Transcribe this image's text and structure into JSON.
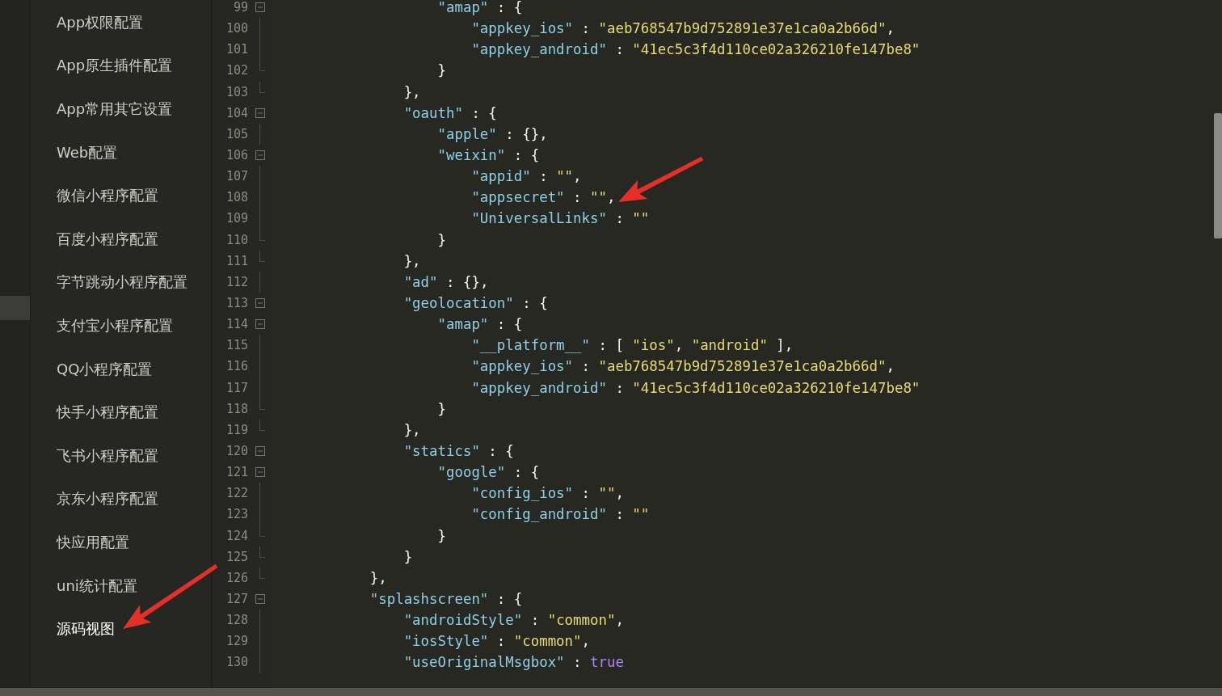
{
  "sidebar": {
    "items": [
      {
        "label": "App权限配置",
        "selected": false,
        "arrow": false
      },
      {
        "label": "App原生插件配置",
        "selected": false,
        "arrow": false
      },
      {
        "label": "App常用其它设置",
        "selected": false,
        "arrow": false
      },
      {
        "label": "Web配置",
        "selected": false,
        "arrow": false
      },
      {
        "label": "微信小程序配置",
        "selected": false,
        "arrow": false
      },
      {
        "label": "百度小程序配置",
        "selected": false,
        "arrow": false
      },
      {
        "label": "字节跳动小程序配置",
        "selected": false,
        "arrow": false
      },
      {
        "label": "支付宝小程序配置",
        "selected": false,
        "arrow": false
      },
      {
        "label": "QQ小程序配置",
        "selected": false,
        "arrow": false
      },
      {
        "label": "快手小程序配置",
        "selected": false,
        "arrow": false
      },
      {
        "label": "飞书小程序配置",
        "selected": false,
        "arrow": false
      },
      {
        "label": "京东小程序配置",
        "selected": false,
        "arrow": false
      },
      {
        "label": "快应用配置",
        "selected": false,
        "arrow": false
      },
      {
        "label": "uni统计配置",
        "selected": false,
        "arrow": false
      },
      {
        "label": "源码视图",
        "selected": true,
        "arrow": true
      }
    ]
  },
  "editor": {
    "lines": [
      {
        "number": "99",
        "fold_start": true,
        "fold_end": false,
        "arrow": false,
        "tokens": [
          {
            "kind": "key",
            "text": "                \"amap\""
          },
          {
            "kind": "plain",
            "text": " : {"
          }
        ]
      },
      {
        "number": "100",
        "fold_start": false,
        "fold_end": false,
        "arrow": false,
        "tokens": [
          {
            "kind": "key",
            "text": "                    \"appkey_ios\""
          },
          {
            "kind": "plain",
            "text": " : "
          },
          {
            "kind": "string",
            "text": "\"aeb768547b9d752891e37e1ca0a2b66d\""
          },
          {
            "kind": "plain",
            "text": ","
          }
        ]
      },
      {
        "number": "101",
        "fold_start": false,
        "fold_end": false,
        "arrow": false,
        "tokens": [
          {
            "kind": "key",
            "text": "                    \"appkey_android\""
          },
          {
            "kind": "plain",
            "text": " : "
          },
          {
            "kind": "string",
            "text": "\"41ec5c3f4d110ce02a326210fe147be8\""
          }
        ]
      },
      {
        "number": "102",
        "fold_start": false,
        "fold_end": true,
        "arrow": false,
        "tokens": [
          {
            "kind": "plain",
            "text": "                }"
          }
        ]
      },
      {
        "number": "103",
        "fold_start": false,
        "fold_end": true,
        "arrow": false,
        "tokens": [
          {
            "kind": "plain",
            "text": "            },"
          }
        ]
      },
      {
        "number": "104",
        "fold_start": true,
        "fold_end": false,
        "arrow": false,
        "tokens": [
          {
            "kind": "key",
            "text": "            \"oauth\""
          },
          {
            "kind": "plain",
            "text": " : {"
          }
        ]
      },
      {
        "number": "105",
        "fold_start": false,
        "fold_end": false,
        "arrow": false,
        "tokens": [
          {
            "kind": "key",
            "text": "                \"apple\""
          },
          {
            "kind": "plain",
            "text": " : {},"
          }
        ]
      },
      {
        "number": "106",
        "fold_start": true,
        "fold_end": false,
        "arrow": false,
        "tokens": [
          {
            "kind": "key",
            "text": "                \"weixin\""
          },
          {
            "kind": "plain",
            "text": " : {"
          }
        ]
      },
      {
        "number": "107",
        "fold_start": false,
        "fold_end": false,
        "arrow": false,
        "tokens": [
          {
            "kind": "key",
            "text": "                    \"appid\""
          },
          {
            "kind": "plain",
            "text": " : "
          },
          {
            "kind": "string",
            "text": "\"\""
          },
          {
            "kind": "plain",
            "text": ","
          }
        ]
      },
      {
        "number": "108",
        "fold_start": false,
        "fold_end": false,
        "arrow": true,
        "tokens": [
          {
            "kind": "key",
            "text": "                    \"appsecret\""
          },
          {
            "kind": "plain",
            "text": " : "
          },
          {
            "kind": "string",
            "text": "\"\""
          },
          {
            "kind": "plain",
            "text": ","
          }
        ]
      },
      {
        "number": "109",
        "fold_start": false,
        "fold_end": false,
        "arrow": false,
        "tokens": [
          {
            "kind": "key",
            "text": "                    \"UniversalLinks\""
          },
          {
            "kind": "plain",
            "text": " : "
          },
          {
            "kind": "string",
            "text": "\"\""
          }
        ]
      },
      {
        "number": "110",
        "fold_start": false,
        "fold_end": true,
        "arrow": false,
        "tokens": [
          {
            "kind": "plain",
            "text": "                }"
          }
        ]
      },
      {
        "number": "111",
        "fold_start": false,
        "fold_end": true,
        "arrow": false,
        "tokens": [
          {
            "kind": "plain",
            "text": "            },"
          }
        ]
      },
      {
        "number": "112",
        "fold_start": false,
        "fold_end": false,
        "arrow": false,
        "tokens": [
          {
            "kind": "key",
            "text": "            \"ad\""
          },
          {
            "kind": "plain",
            "text": " : {},"
          }
        ]
      },
      {
        "number": "113",
        "fold_start": true,
        "fold_end": false,
        "arrow": false,
        "tokens": [
          {
            "kind": "key",
            "text": "            \"geolocation\""
          },
          {
            "kind": "plain",
            "text": " : {"
          }
        ]
      },
      {
        "number": "114",
        "fold_start": true,
        "fold_end": false,
        "arrow": false,
        "tokens": [
          {
            "kind": "key",
            "text": "                \"amap\""
          },
          {
            "kind": "plain",
            "text": " : {"
          }
        ]
      },
      {
        "number": "115",
        "fold_start": false,
        "fold_end": false,
        "arrow": false,
        "tokens": [
          {
            "kind": "key",
            "text": "                    \"__platform__\""
          },
          {
            "kind": "plain",
            "text": " : [ "
          },
          {
            "kind": "string",
            "text": "\"ios\""
          },
          {
            "kind": "plain",
            "text": ", "
          },
          {
            "kind": "string",
            "text": "\"android\""
          },
          {
            "kind": "plain",
            "text": " ],"
          }
        ]
      },
      {
        "number": "116",
        "fold_start": false,
        "fold_end": false,
        "arrow": false,
        "tokens": [
          {
            "kind": "key",
            "text": "                    \"appkey_ios\""
          },
          {
            "kind": "plain",
            "text": " : "
          },
          {
            "kind": "string",
            "text": "\"aeb768547b9d752891e37e1ca0a2b66d\""
          },
          {
            "kind": "plain",
            "text": ","
          }
        ]
      },
      {
        "number": "117",
        "fold_start": false,
        "fold_end": false,
        "arrow": false,
        "tokens": [
          {
            "kind": "key",
            "text": "                    \"appkey_android\""
          },
          {
            "kind": "plain",
            "text": " : "
          },
          {
            "kind": "string",
            "text": "\"41ec5c3f4d110ce02a326210fe147be8\""
          }
        ]
      },
      {
        "number": "118",
        "fold_start": false,
        "fold_end": true,
        "arrow": false,
        "tokens": [
          {
            "kind": "plain",
            "text": "                }"
          }
        ]
      },
      {
        "number": "119",
        "fold_start": false,
        "fold_end": true,
        "arrow": false,
        "tokens": [
          {
            "kind": "plain",
            "text": "            },"
          }
        ]
      },
      {
        "number": "120",
        "fold_start": true,
        "fold_end": false,
        "arrow": false,
        "tokens": [
          {
            "kind": "key",
            "text": "            \"statics\""
          },
          {
            "kind": "plain",
            "text": " : {"
          }
        ]
      },
      {
        "number": "121",
        "fold_start": true,
        "fold_end": false,
        "arrow": false,
        "tokens": [
          {
            "kind": "key",
            "text": "                \"google\""
          },
          {
            "kind": "plain",
            "text": " : {"
          }
        ]
      },
      {
        "number": "122",
        "fold_start": false,
        "fold_end": false,
        "arrow": false,
        "tokens": [
          {
            "kind": "key",
            "text": "                    \"config_ios\""
          },
          {
            "kind": "plain",
            "text": " : "
          },
          {
            "kind": "string",
            "text": "\"\""
          },
          {
            "kind": "plain",
            "text": ","
          }
        ]
      },
      {
        "number": "123",
        "fold_start": false,
        "fold_end": false,
        "arrow": false,
        "tokens": [
          {
            "kind": "key",
            "text": "                    \"config_android\""
          },
          {
            "kind": "plain",
            "text": " : "
          },
          {
            "kind": "string",
            "text": "\"\""
          }
        ]
      },
      {
        "number": "124",
        "fold_start": false,
        "fold_end": true,
        "arrow": false,
        "tokens": [
          {
            "kind": "plain",
            "text": "                }"
          }
        ]
      },
      {
        "number": "125",
        "fold_start": false,
        "fold_end": true,
        "arrow": false,
        "tokens": [
          {
            "kind": "plain",
            "text": "            }"
          }
        ]
      },
      {
        "number": "126",
        "fold_start": false,
        "fold_end": true,
        "arrow": false,
        "tokens": [
          {
            "kind": "plain",
            "text": "        },"
          }
        ]
      },
      {
        "number": "127",
        "fold_start": true,
        "fold_end": false,
        "arrow": false,
        "tokens": [
          {
            "kind": "key",
            "text": "        \"splashscreen\""
          },
          {
            "kind": "plain",
            "text": " : {"
          }
        ]
      },
      {
        "number": "128",
        "fold_start": false,
        "fold_end": false,
        "arrow": false,
        "tokens": [
          {
            "kind": "key",
            "text": "            \"androidStyle\""
          },
          {
            "kind": "plain",
            "text": " : "
          },
          {
            "kind": "string",
            "text": "\"common\""
          },
          {
            "kind": "plain",
            "text": ","
          }
        ]
      },
      {
        "number": "129",
        "fold_start": false,
        "fold_end": false,
        "arrow": false,
        "tokens": [
          {
            "kind": "key",
            "text": "            \"iosStyle\""
          },
          {
            "kind": "plain",
            "text": " : "
          },
          {
            "kind": "string",
            "text": "\"common\""
          },
          {
            "kind": "plain",
            "text": ","
          }
        ]
      },
      {
        "number": "130",
        "fold_start": false,
        "fold_end": false,
        "arrow": false,
        "tokens": [
          {
            "kind": "key",
            "text": "            \"useOriginalMsgbox\""
          },
          {
            "kind": "plain",
            "text": " : "
          },
          {
            "kind": "literal",
            "text": "true"
          }
        ]
      }
    ]
  }
}
